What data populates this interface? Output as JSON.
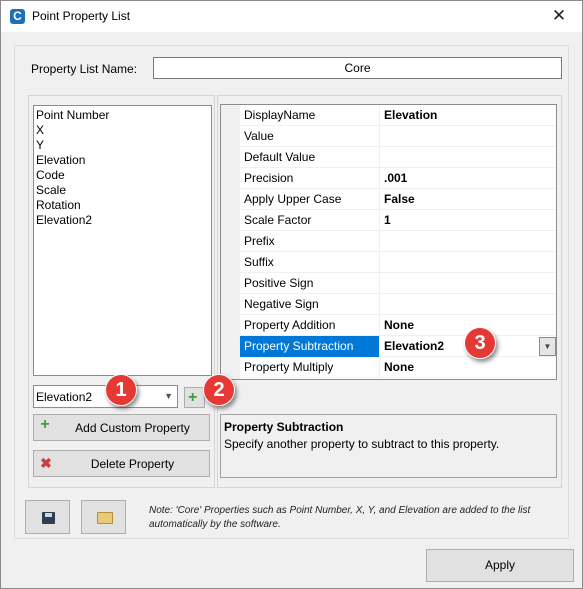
{
  "window": {
    "title": "Point Property List",
    "close_glyph": "✕"
  },
  "property_list_name": {
    "label": "Property List Name:",
    "value": "Core"
  },
  "properties": [
    "Point Number",
    "X",
    "Y",
    "Elevation",
    "Code",
    "Scale",
    "Rotation",
    "Elevation2"
  ],
  "custom_property_combo": {
    "value": "Elevation2"
  },
  "buttons": {
    "add_custom": "Add Custom Property",
    "delete": "Delete Property",
    "apply": "Apply"
  },
  "grid_rows": [
    {
      "name": "DisplayName",
      "value": "Elevation"
    },
    {
      "name": "Value",
      "value": ""
    },
    {
      "name": "Default Value",
      "value": ""
    },
    {
      "name": "Precision",
      "value": ".001"
    },
    {
      "name": "Apply Upper Case",
      "value": "False"
    },
    {
      "name": "Scale Factor",
      "value": "1"
    },
    {
      "name": "Prefix",
      "value": ""
    },
    {
      "name": "Suffix",
      "value": ""
    },
    {
      "name": "Positive Sign",
      "value": ""
    },
    {
      "name": "Negative Sign",
      "value": ""
    },
    {
      "name": "Property Addition",
      "value": "None"
    },
    {
      "name": "Property Subtraction",
      "value": "Elevation2"
    },
    {
      "name": "Property Multiply",
      "value": "None"
    }
  ],
  "selected_row_index": 11,
  "help": {
    "title": "Property Subtraction",
    "description": "Specify another property to subtract to this property."
  },
  "note": "Note: 'Core' Properties such as Point Number, X, Y, and Elevation are added to the list automatically by the software.",
  "badges": [
    "1",
    "2",
    "3"
  ],
  "icons": {
    "app": "civil-app-icon",
    "save": "save-icon",
    "open": "folder-icon",
    "add": "plus-icon",
    "delete": "delete-x-icon"
  },
  "colors": {
    "selection": "#0078d7",
    "badge": "#e53935",
    "plus": "#3aa03a"
  }
}
